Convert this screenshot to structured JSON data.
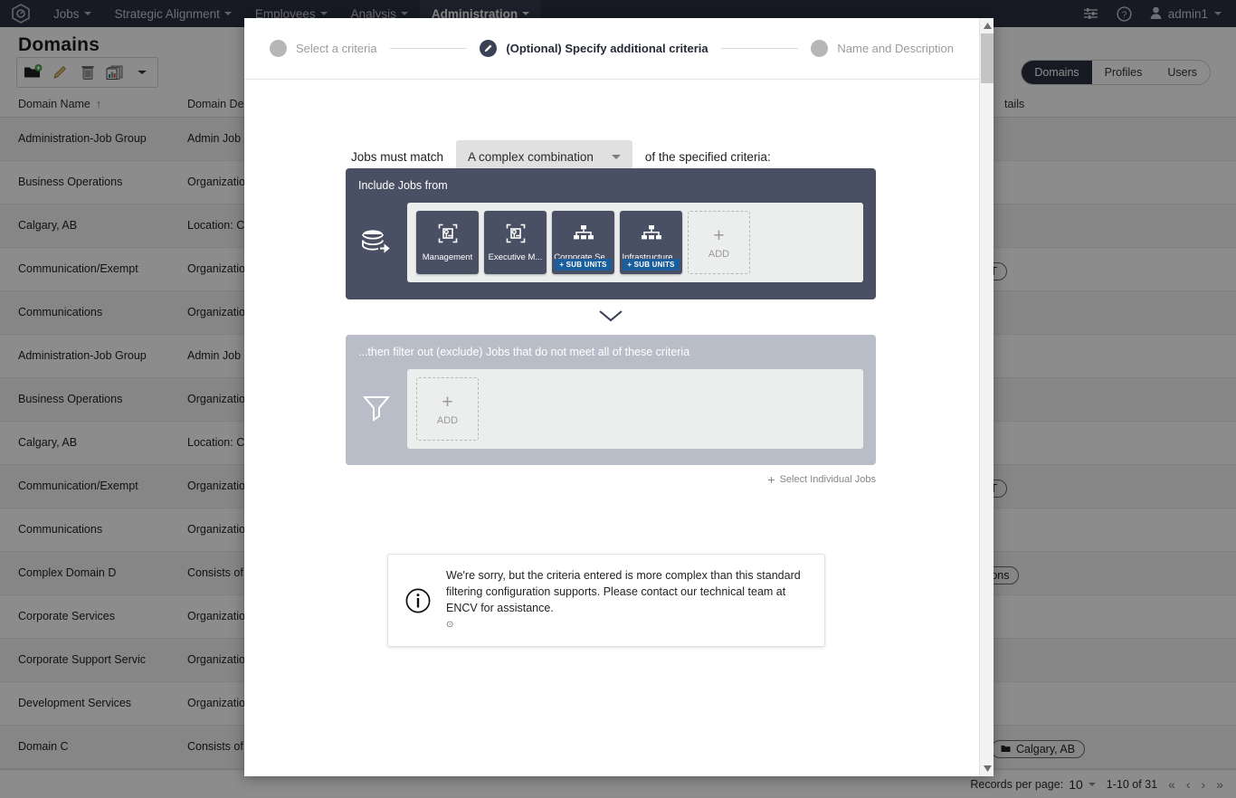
{
  "topbar": {
    "logo_icon": "app-logo-icon",
    "nav": [
      {
        "label": "Jobs",
        "active": false
      },
      {
        "label": "Strategic Alignment",
        "active": false
      },
      {
        "label": "Employees",
        "active": false
      },
      {
        "label": "Analysis",
        "active": false
      },
      {
        "label": "Administration",
        "active": true
      }
    ],
    "settings_icon": "sliders-icon",
    "help_icon": "help-circle-icon",
    "user_icon": "user-icon",
    "user_label": "admin1"
  },
  "page": {
    "title": "Domains",
    "toolbar": [
      {
        "name": "new-domain-button",
        "icon": "folder-add-icon"
      },
      {
        "name": "edit-domain-button",
        "icon": "pencil-icon"
      },
      {
        "name": "delete-domain-button",
        "icon": "trash-icon"
      },
      {
        "name": "copy-domain-button",
        "icon": "copy-reports-icon"
      },
      {
        "name": "more-actions-button",
        "icon": "chevron-down-icon"
      }
    ],
    "tabs": [
      {
        "label": "Domains",
        "active": true
      },
      {
        "label": "Profiles",
        "active": false
      },
      {
        "label": "Users",
        "active": false
      }
    ],
    "columns": [
      {
        "label": "Domain Name",
        "sort": "↑"
      },
      {
        "label": "Domain Desc"
      },
      {
        "label": "tails"
      }
    ],
    "rows": [
      {
        "name": "Administration-Job Group",
        "desc": "Admin Job E",
        "detail": ""
      },
      {
        "name": "Business Operations",
        "desc": "Organization",
        "detail": ""
      },
      {
        "name": "Calgary, AB",
        "desc": "Location: Ca",
        "detail": ""
      },
      {
        "name": "Communication/Exempt",
        "desc": "Organization",
        "detail": "PT"
      },
      {
        "name": "Communications",
        "desc": "Organization",
        "detail": ""
      },
      {
        "name": "Administration-Job Group",
        "desc": "Admin Job E",
        "detail": ""
      },
      {
        "name": "Business Operations",
        "desc": "Organization",
        "detail": ""
      },
      {
        "name": "Calgary, AB",
        "desc": "Location: Ca",
        "detail": ""
      },
      {
        "name": "Communication/Exempt",
        "desc": "Organization",
        "detail": "PT"
      },
      {
        "name": "Communications",
        "desc": "Organization",
        "detail": ""
      },
      {
        "name": "Complex Domain D",
        "desc": "Consists of D",
        "detail": "erations"
      },
      {
        "name": "Corporate Services",
        "desc": "Organization",
        "detail": ""
      },
      {
        "name": "Corporate Support Servic",
        "desc": "Organization",
        "detail": ""
      },
      {
        "name": "Development Services",
        "desc": "Organization",
        "detail": ""
      },
      {
        "name": "Domain C",
        "desc": "Consists of J",
        "detail": "Calgary, AB"
      }
    ],
    "footer": {
      "records_label": "Records per page:",
      "records_value": "10",
      "range": "1-10 of 31",
      "first_icon": "«",
      "prev_icon": "‹",
      "next_icon": "›",
      "last_icon": "»"
    }
  },
  "modal": {
    "steps": [
      {
        "label": "Select a criteria",
        "state": "pending",
        "icon": "step-dot-icon"
      },
      {
        "label": "(Optional) Specify additional criteria",
        "state": "active",
        "icon": "pencil-step-icon"
      },
      {
        "label": "Name and Description",
        "state": "pending",
        "icon": "step-dot-icon"
      }
    ],
    "match": {
      "prefix": "Jobs must match",
      "value": "A complex combination",
      "suffix": "of the specified criteria:",
      "dropdown_icon": "chevron-down-icon"
    },
    "include": {
      "title": "Include Jobs from",
      "side_icon": "database-include-icon",
      "tiles": [
        {
          "label": "Management",
          "icon": "job-position-icon",
          "badge": ""
        },
        {
          "label": "Executive M...",
          "icon": "job-position-icon",
          "badge": ""
        },
        {
          "label": "Corporate Se...",
          "icon": "org-unit-icon",
          "badge": "+ SUB UNITS"
        },
        {
          "label": "Infrastructure...",
          "icon": "org-unit-icon",
          "badge": "+ SUB UNITS"
        }
      ],
      "add_plus": "+",
      "add_label": "ADD"
    },
    "connector_icon": "chevron-down-icon",
    "exclude": {
      "title": "...then filter out (exclude) Jobs that do not meet all of these criteria",
      "side_icon": "filter-funnel-icon",
      "add_plus": "+",
      "add_label": "ADD"
    },
    "select_individual": {
      "plus": "+",
      "label": "Select Individual Jobs"
    },
    "info": {
      "icon": "info-circle-icon",
      "text": "We're sorry, but the criteria entered is more complex than this standard filtering configuration supports. Please contact our technical team at ENCV for assistance.",
      "sub_icon": "⊙"
    },
    "scroll_up_icon": "scroll-up-arrow-icon",
    "scroll_down_icon": "scroll-down-arrow-icon"
  },
  "colors": {
    "topbar_bg": "#2b3040",
    "panel_dark": "#4a5064",
    "panel_light": "#b9bdc7",
    "badge_blue": "#1b5e9e",
    "tile_strip": "#eceded"
  }
}
